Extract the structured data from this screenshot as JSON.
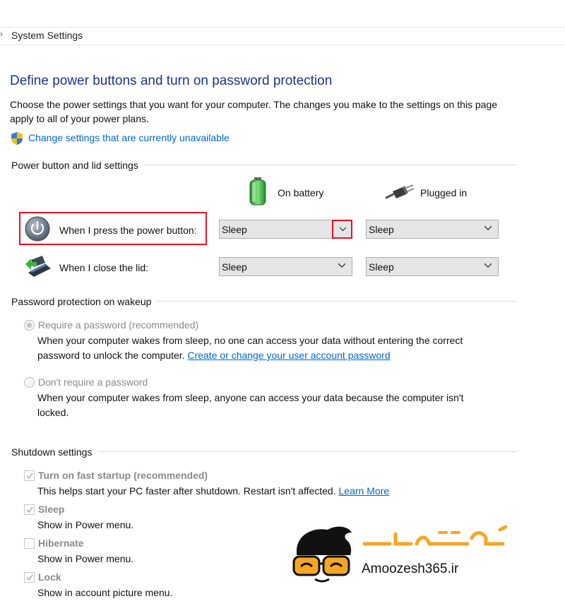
{
  "breadcrumb": {
    "current": "System Settings"
  },
  "page": {
    "title": "Define power buttons and turn on password protection",
    "description": "Choose the power settings that you want for your computer. The changes you make to the settings on this page apply to all of your power plans.",
    "change_link": "Change settings that are currently unavailable"
  },
  "power_section": {
    "heading": "Power button and lid settings",
    "col_battery": "On battery",
    "col_plugged": "Plugged in",
    "rows": [
      {
        "label": "When I press the power button:",
        "battery": "Sleep",
        "plugged": "Sleep"
      },
      {
        "label": "When I close the lid:",
        "battery": "Sleep",
        "plugged": "Sleep"
      }
    ]
  },
  "password_section": {
    "heading": "Password protection on wakeup",
    "require": {
      "label": "Require a password (recommended)",
      "desc_line1": "When your computer wakes from sleep, no one can access your data without entering the correct",
      "desc_line2": "password to unlock the computer.",
      "link": "Create or change your user account password",
      "selected": true
    },
    "dont_require": {
      "label": "Don't require a password",
      "desc_line1": "When your computer wakes from sleep, anyone can access your data because the computer isn't",
      "desc_line2": "locked.",
      "selected": false
    }
  },
  "shutdown_section": {
    "heading": "Shutdown settings",
    "items": [
      {
        "label": "Turn on fast startup (recommended)",
        "desc": "This helps start your PC faster after shutdown. Restart isn't affected.",
        "link": "Learn More",
        "checked": true
      },
      {
        "label": "Sleep",
        "desc": "Show in Power menu.",
        "checked": true
      },
      {
        "label": "Hibernate",
        "desc": "Show in Power menu.",
        "checked": false
      },
      {
        "label": "Lock",
        "desc": "Show in account picture menu.",
        "checked": true
      }
    ]
  },
  "watermark": {
    "logo_text": "آمـوزش ۳۶۵",
    "site": "Amoozesh365.ir"
  },
  "colors": {
    "title": "#1e3287",
    "link": "#0066cc",
    "highlight": "#e81123",
    "watermark_orange": "#f5a623"
  }
}
